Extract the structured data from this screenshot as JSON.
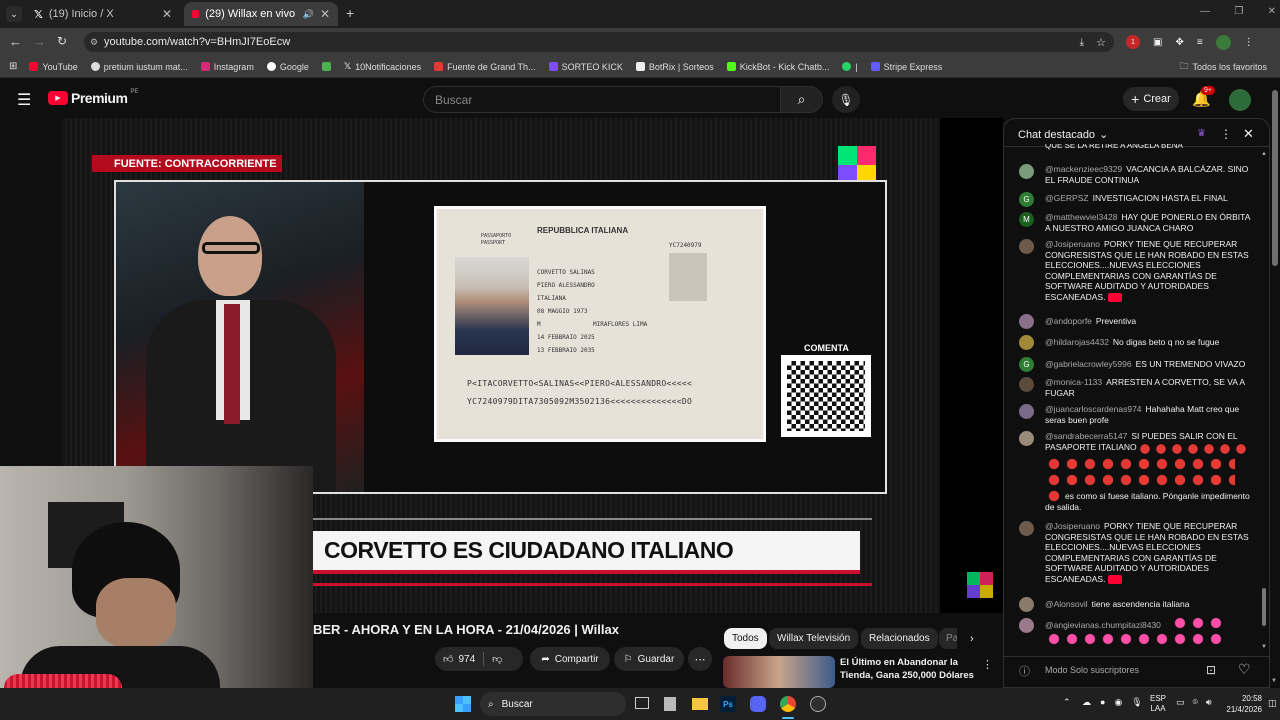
{
  "browser": {
    "tabs": [
      {
        "label": "(19) Inicio / X"
      },
      {
        "label": "(29) Willax en vivo - CONTR"
      }
    ],
    "url": "youtube.com/watch?v=BHmJI7EoEcw",
    "bookmarks": [
      "YouTube",
      "pretium iustum mat...",
      "Instagram",
      "Google",
      "10Notificaciones",
      "Fuente de Grand Th...",
      "SORTEO KICK",
      "BotRix | Sorteos",
      "KickBot - Kick Chatb...",
      "|",
      "Stripe Express"
    ],
    "all_bookmarks": "Todos los favoritos",
    "ext_badge": "1"
  },
  "youtube": {
    "logo": "Premium",
    "logo_region": "PE",
    "search_placeholder": "Buscar",
    "create_label": "Crear",
    "notif_count": "9+"
  },
  "video": {
    "source_banner": "FUENTE: CONTRACORRIENTE",
    "comenta": "COMENTA",
    "headline": "CORVETTO ES CIUDADANO ITALIANO",
    "passport": {
      "country": "REPUBBLICA ITALIANA",
      "type": "PASSAPORTO",
      "type2": "PASSPORT",
      "code": "YC7240979",
      "surname": "CORVETTO SALINAS",
      "name": "PIERO ALESSANDRO",
      "nationality": "ITALIANA",
      "birth": "08 MAGGIO 1973",
      "sex": "M",
      "place": "MIRAFLORES LIMA",
      "issue": "14 FEBBRAIO 2025",
      "expiry": "13 FEBBRAIO 2035",
      "mrz1": "P<ITACORVETTO<SALINAS<<PIERO<ALESSANDRO<<<<<",
      "mrz2": "YC7240979DITA7305092M3502136<<<<<<<<<<<<<<DO"
    }
  },
  "below_video": {
    "title_partial": "BER - AHORA Y EN LA HORA - 21/04/2026 | Willax",
    "likes": "974",
    "share": "Compartir",
    "save": "Guardar",
    "chips": [
      "Todos",
      "Willax Televisión",
      "Relacionados",
      "Pa"
    ],
    "rec_title": "El Último en Abandonar la Tienda, Gana 250,000 Dólares"
  },
  "chat": {
    "title": "Chat destacado",
    "top_partial": "QUE SE LA RETIRE A ANGELA BENA",
    "messages": [
      {
        "user": "@mackenzieec9329",
        "text": "VACANCIA A BALCÁZAR. SINO EL FRAUDE CONTINUA",
        "avatar": "",
        "color": "#7a9b7a"
      },
      {
        "user": "@GERPSZ",
        "text": "INVESTIGACION HASTA EL FINAL",
        "avatar": "G",
        "color": "#2e7d32"
      },
      {
        "user": "@matthewviel3428",
        "text": "HAY QUE PONERLO EN ÓRBITA A NUESTRO AMIGO JUANCA CHARO",
        "avatar": "M",
        "color": "#1b5e20"
      },
      {
        "user": "@Josiperuano",
        "text": "PORKY TIENE QUE RECUPERAR CONGRESISTAS QUE LE HAN ROBADO EN ESTAS ELECCIONES....NUEVAS ELECCIONES COMPLEMENTARIAS CON GARANTÍAS DE SOFTWARE AUDITADO Y AUTORIDADES ESCANEADAS.",
        "avatar": "",
        "color": "#6d5a4a"
      },
      {
        "user": "@andoporfe",
        "text": "Preventiva",
        "avatar": "",
        "color": "#8a6f8a"
      },
      {
        "user": "@hildarojas4432",
        "text": "No digas beto q no se fugue",
        "avatar": "",
        "color": "#a08a3a"
      },
      {
        "user": "@gabrielacrowley5996",
        "text": "ES UN TREMENDO VIVAZO",
        "avatar": "G",
        "color": "#2e7d32"
      },
      {
        "user": "@monica-1133",
        "text": "ARRESTEN A CORVETTO, SE VA A FUGAR",
        "avatar": "",
        "color": "#5a4a3a"
      },
      {
        "user": "@juancarloscardenas974",
        "text": "Hahahaha Matt creo que seras buen profe",
        "avatar": "",
        "color": "#7a6a8a"
      },
      {
        "user": "@sandrabecerra5147",
        "text": "SI PUEDES SALIR CON EL PASAPORTE ITALIANO",
        "avatar": "",
        "color": "#9a8a7a"
      },
      {
        "user": "",
        "text": "es como si fuese italiano. Pónganle impedimento de salida.",
        "avatar": "",
        "color": ""
      },
      {
        "user": "@Josiperuano",
        "text": "PORKY TIENE QUE RECUPERAR CONGRESISTAS QUE LE HAN ROBADO EN ESTAS ELECCIONES....NUEVAS ELECCIONES COMPLEMENTARIAS CON GARANTÍAS DE SOFTWARE AUDITADO Y AUTORIDADES ESCANEADAS.",
        "avatar": "",
        "color": "#6d5a4a"
      },
      {
        "user": "@Alonsovil",
        "text": "tiene ascendencia italiana",
        "avatar": "",
        "color": "#8a7a6a"
      },
      {
        "user": "@angievianas.chumpitazi8430",
        "text": "",
        "avatar": "",
        "color": "#9a7a8a"
      }
    ],
    "footer": "Modo Solo suscriptores"
  },
  "taskbar": {
    "search": "Buscar",
    "lang1": "ESP",
    "lang2": "LAA",
    "time": "20:58",
    "date": "21/4/2026"
  }
}
